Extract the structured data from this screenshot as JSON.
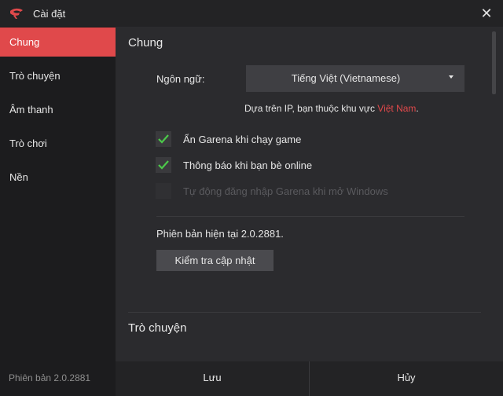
{
  "window": {
    "title": "Cài đặt",
    "close_glyph": "✕",
    "logo_icon": "garena-logo-icon",
    "accent_color": "#e0494b"
  },
  "sidebar": {
    "items": [
      {
        "label": "Chung",
        "active": true
      },
      {
        "label": "Trò chuyện",
        "active": false
      },
      {
        "label": "Âm thanh",
        "active": false
      },
      {
        "label": "Trò chơi",
        "active": false
      },
      {
        "label": "Nền",
        "active": false
      }
    ],
    "version": "Phiên bản 2.0.2881"
  },
  "general": {
    "section_title": "Chung",
    "language_label": "Ngôn ngữ:",
    "language_value": "Tiếng Việt (Vietnamese)",
    "ip_prefix": "Dựa trên IP, bạn thuộc khu vực ",
    "ip_country": "Việt Nam",
    "ip_suffix": ".",
    "options": [
      {
        "label": "Ẩn Garena khi chạy game",
        "checked": true,
        "enabled": true
      },
      {
        "label": "Thông báo khi bạn bè online",
        "checked": true,
        "enabled": true
      },
      {
        "label": "Tự động đăng nhập Garena khi mở Windows",
        "checked": false,
        "enabled": false
      }
    ],
    "current_version": "Phiên bản hiện tại 2.0.2881.",
    "check_update_label": "Kiểm tra cập nhật"
  },
  "chat": {
    "section_title": "Trò chuyện"
  },
  "footer": {
    "save_label": "Lưu",
    "cancel_label": "Hủy"
  }
}
